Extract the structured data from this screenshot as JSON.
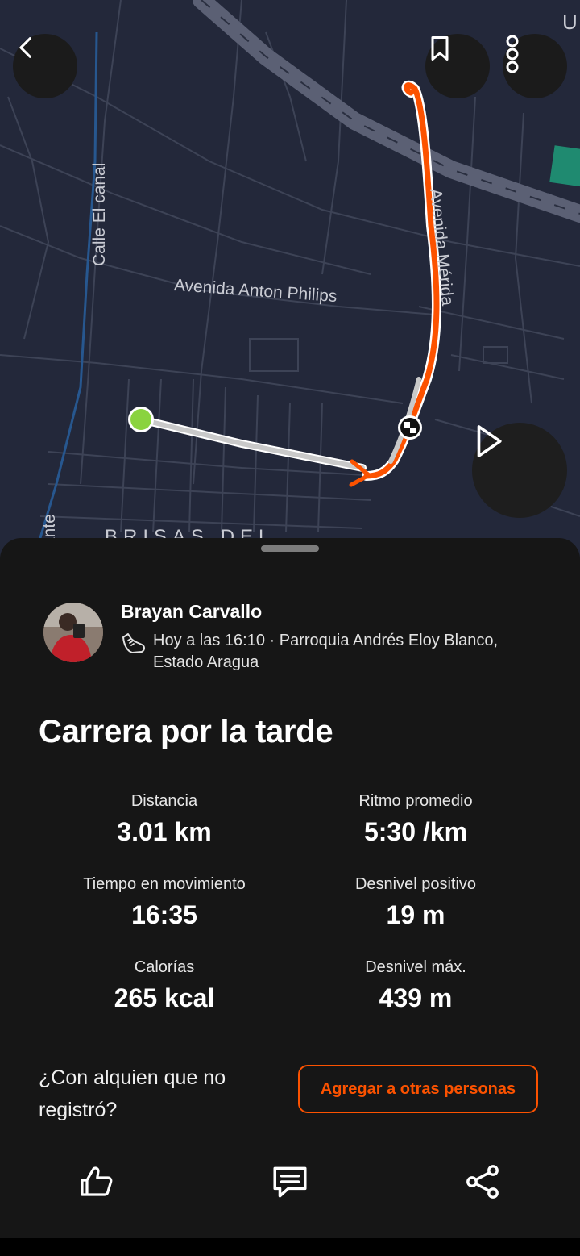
{
  "map": {
    "street_labels": [
      "Calle El canal",
      "Avenida Anton Philips",
      "Avenida Mérida",
      "ante",
      "BRISAS DEL",
      "U"
    ],
    "route_color": "#fc5200",
    "start_color": "#8ad33f"
  },
  "top_buttons": {
    "back_icon": "chevron-left-icon",
    "bookmark_icon": "bookmark-icon",
    "more_icon": "more-vertical-icon"
  },
  "play_icon": "play-icon",
  "athlete": {
    "name": "Brayan Carvallo",
    "activity_icon": "running-shoe-icon",
    "meta": "Hoy a las 16:10 · Parroquia Andrés Eloy Blanco, Estado Aragua"
  },
  "activity": {
    "title": "Carrera por la tarde",
    "stats": [
      {
        "label": "Distancia",
        "value": "3.01 km"
      },
      {
        "label": "Ritmo promedio",
        "value": "5:30 /km"
      },
      {
        "label": "Tiempo en movimiento",
        "value": "16:35"
      },
      {
        "label": "Desnivel positivo",
        "value": "19 m"
      },
      {
        "label": "Calorías",
        "value": "265 kcal"
      },
      {
        "label": "Desnivel máx.",
        "value": "439 m"
      }
    ]
  },
  "others": {
    "question": "¿Con alquien que no registró?",
    "button": "Agregar a otras personas"
  },
  "actions": {
    "kudos_icon": "thumbs-up-icon",
    "comment_icon": "comment-icon",
    "share_icon": "share-icon"
  },
  "colors": {
    "accent": "#fc5200",
    "background": "#161616",
    "map": "#23283a"
  }
}
